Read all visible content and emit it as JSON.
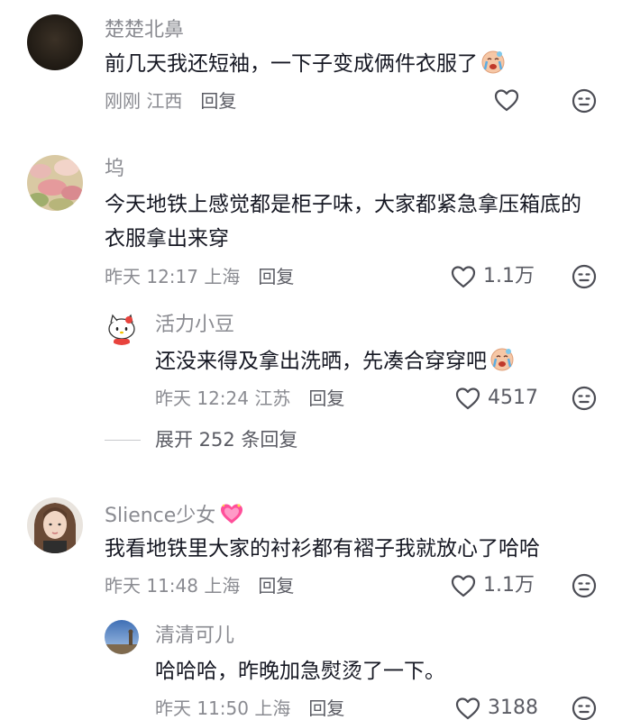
{
  "comments": [
    {
      "username": "楚楚北鼻",
      "text": "前几天我还短袖，一下子变成俩件衣服了",
      "meta": "刚刚 江西",
      "reply": "回复",
      "likes": ""
    },
    {
      "username": "坞",
      "text": "今天地铁上感觉都是柜子味，大家都紧急拿压箱底的衣服拿出来穿",
      "meta": "昨天 12:17 上海",
      "reply": "回复",
      "likes": "1.1万",
      "replies": [
        {
          "username": "活力小豆",
          "text": "还没来得及拿出洗晒，先凑合穿穿吧",
          "meta": "昨天 12:24 江苏",
          "reply": "回复",
          "likes": "4517"
        }
      ],
      "expand_label": "展开 252 条回复"
    },
    {
      "username": "Slience少女",
      "text": "我看地铁里大家的衬衫都有褶子我就放心了哈哈",
      "meta": "昨天 11:48 上海",
      "reply": "回复",
      "likes": "1.1万",
      "replies": [
        {
          "username": "清清可儿",
          "text": "哈哈哈，昨晚加急熨烫了一下。",
          "meta": "昨天 11:50 上海",
          "reply": "回复",
          "likes": "3188"
        }
      ]
    }
  ],
  "colors": {
    "text_primary": "#161823",
    "text_secondary": "#8a8b91",
    "heart_pink": "#ff4f9a"
  },
  "icons": [
    "crying-emoji-icon",
    "heart-outline-icon",
    "dislike-face-icon",
    "sparkling-heart-icon"
  ]
}
